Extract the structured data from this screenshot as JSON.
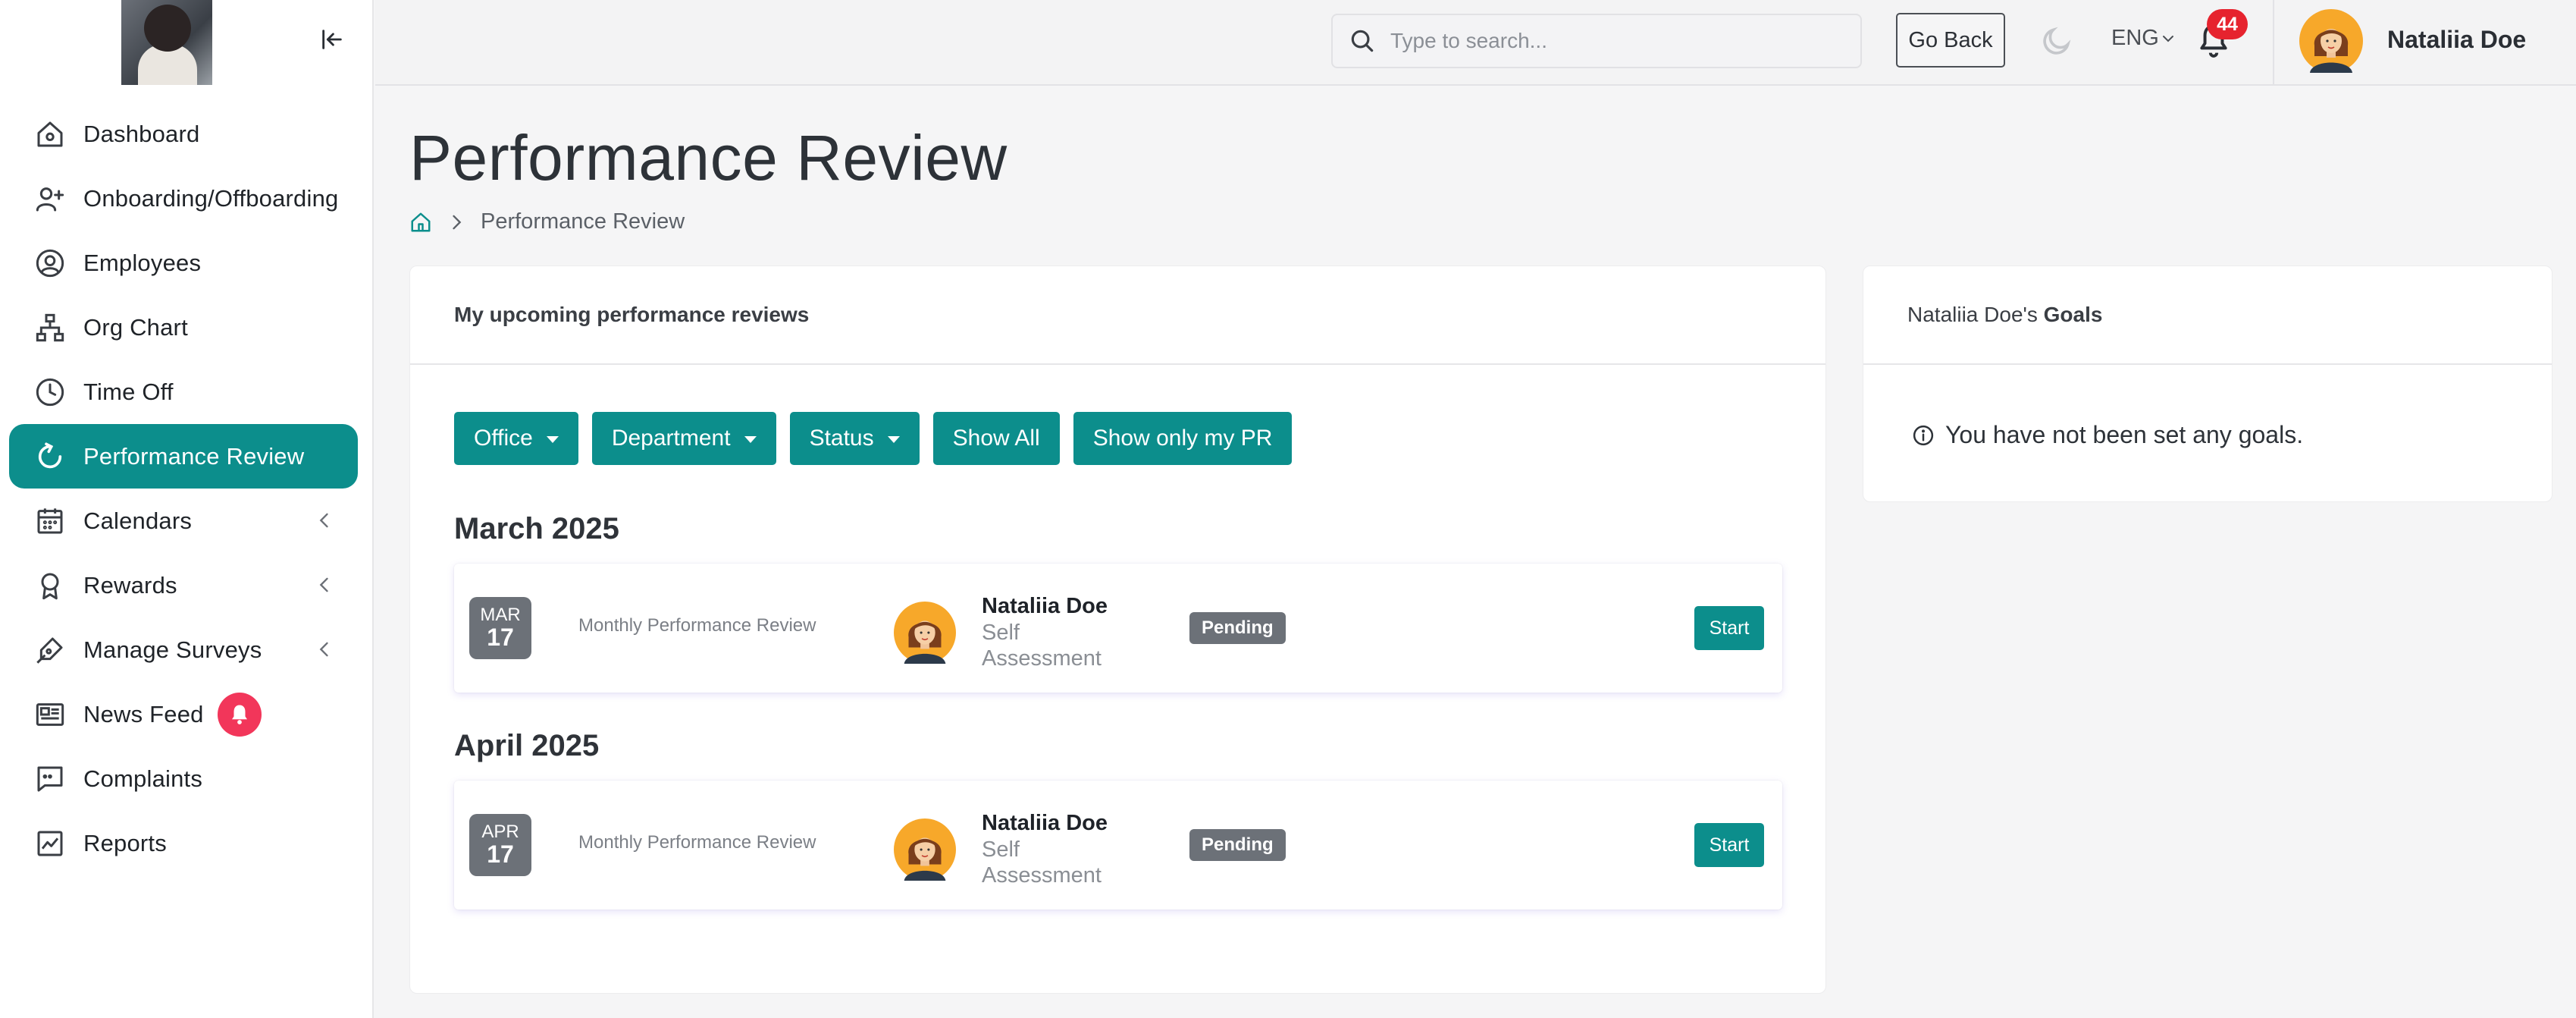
{
  "sidebar": {
    "items": [
      {
        "label": "Dashboard"
      },
      {
        "label": "Onboarding/Offboarding"
      },
      {
        "label": "Employees"
      },
      {
        "label": "Org Chart"
      },
      {
        "label": "Time Off"
      },
      {
        "label": "Performance Review"
      },
      {
        "label": "Calendars"
      },
      {
        "label": "Rewards"
      },
      {
        "label": "Manage Surveys"
      },
      {
        "label": "News Feed"
      },
      {
        "label": "Complaints"
      },
      {
        "label": "Reports"
      }
    ],
    "active_index": 5
  },
  "topbar": {
    "search_placeholder": "Type to search...",
    "go_back_label": "Go Back",
    "language": "ENG",
    "notification_count": "44",
    "user_name": "Nataliia Doe"
  },
  "page": {
    "title": "Performance Review",
    "breadcrumb": "Performance Review"
  },
  "reviews_card": {
    "header": "My upcoming performance reviews",
    "filters": {
      "office": "Office",
      "department": "Department",
      "status": "Status",
      "show_all": "Show All",
      "show_mine": "Show only my PR"
    },
    "groups": [
      {
        "month": "March 2025",
        "review": {
          "date_month": "MAR",
          "date_day": "17",
          "title": "Monthly Performance Review",
          "person": "Nataliia Doe",
          "type": "Self Assessment",
          "status": "Pending",
          "action": "Start"
        }
      },
      {
        "month": "April 2025",
        "review": {
          "date_month": "APR",
          "date_day": "17",
          "title": "Monthly Performance Review",
          "person": "Nataliia Doe",
          "type": "Self Assessment",
          "status": "Pending",
          "action": "Start"
        }
      }
    ]
  },
  "goals_card": {
    "header_prefix": "Nataliia Doe's ",
    "header_bold": "Goals",
    "empty_message": "You have not been set any goals."
  },
  "colors": {
    "accent": "#0c8e8c",
    "badge_gray": "#6c7178",
    "notification_red": "#e6232e",
    "news_feed_badge": "#f2365a"
  }
}
